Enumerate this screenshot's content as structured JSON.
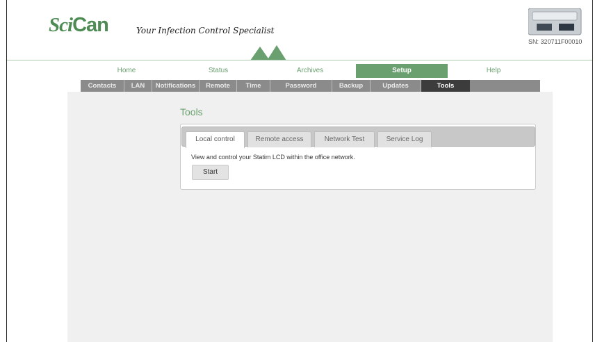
{
  "header": {
    "logo_sci": "Sci",
    "logo_can": "Can",
    "tagline": "Your Infection Control Specialist",
    "serial": "SN: 320711F00010"
  },
  "main_nav": [
    {
      "label": "Home",
      "active": false
    },
    {
      "label": "Status",
      "active": false
    },
    {
      "label": "Archives",
      "active": false
    },
    {
      "label": "Setup",
      "active": true
    },
    {
      "label": "Help",
      "active": false
    }
  ],
  "sub_nav": [
    {
      "label": "Contacts",
      "active": false
    },
    {
      "label": "LAN",
      "active": false
    },
    {
      "label": "Notifications",
      "active": false
    },
    {
      "label": "Remote",
      "active": false
    },
    {
      "label": "Time",
      "active": false
    },
    {
      "label": "Password",
      "active": false
    },
    {
      "label": "Backup",
      "active": false
    },
    {
      "label": "Updates",
      "active": false
    },
    {
      "label": "Tools",
      "active": true
    }
  ],
  "panel": {
    "title": "Tools",
    "tabs": [
      {
        "label": "Local control",
        "active": true
      },
      {
        "label": "Remote access",
        "active": false
      },
      {
        "label": "Network Test",
        "active": false
      },
      {
        "label": "Service Log",
        "active": false
      }
    ],
    "description": "View and control your Statim LCD within the office network.",
    "start_label": "Start"
  },
  "colors": {
    "brand_green": "#6aa06f",
    "subnav_gray": "#8b8b8b",
    "subnav_active": "#3c3c3c"
  },
  "icons": [
    "logo-peaks-icon",
    "device-image-icon"
  ]
}
